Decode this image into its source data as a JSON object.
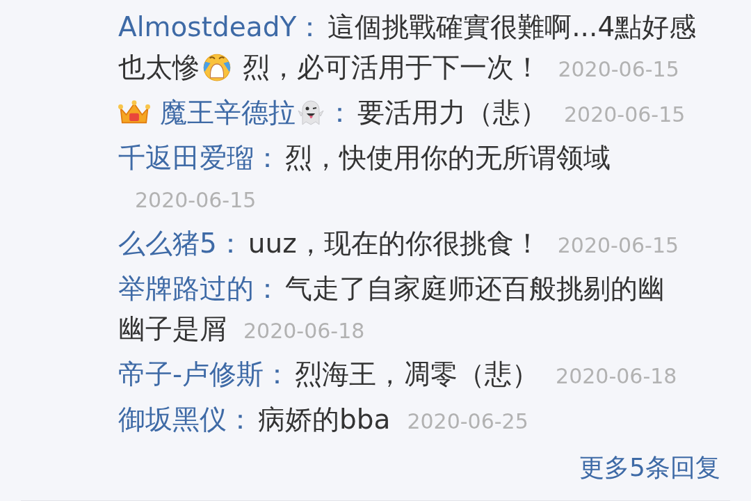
{
  "replies": [
    {
      "user": "AlmostdeadY",
      "separator": "：",
      "content": [
        {
          "kind": "text",
          "value": "這個挑戰確實很難啊...4點好感"
        },
        {
          "kind": "break"
        },
        {
          "kind": "text",
          "value": "也太慘"
        },
        {
          "kind": "crying_emoji"
        },
        {
          "kind": "text",
          "value": " 烈，必可活用于下一次！"
        }
      ],
      "date": "2020-06-15"
    },
    {
      "badge": {
        "kind": "crown"
      },
      "user": "魔王辛德拉",
      "name_emoji": {
        "kind": "ghost"
      },
      "separator": "：",
      "content": [
        {
          "kind": "text",
          "value": "要活用力（悲）"
        }
      ],
      "date": "2020-06-15"
    },
    {
      "user": "千返田爱瑠",
      "separator": "：",
      "content": [
        {
          "kind": "text",
          "value": "烈，快使用你的无所谓领域"
        }
      ],
      "date": "2020-06-15"
    },
    {
      "user": "么么猪5",
      "separator": "：",
      "content": [
        {
          "kind": "text",
          "value": "uuz，现在的你很挑食！"
        }
      ],
      "date": "2020-06-15"
    },
    {
      "user": "举牌路过的",
      "separator": "：",
      "content": [
        {
          "kind": "text",
          "value": "气走了自家庭师还百般挑剔的幽"
        },
        {
          "kind": "break"
        },
        {
          "kind": "text",
          "value": "幽子是屑"
        }
      ],
      "date": "2020-06-18"
    },
    {
      "user": "帝子-卢修斯",
      "separator": "：",
      "content": [
        {
          "kind": "text",
          "value": "烈海王，凋零（悲）"
        }
      ],
      "date": "2020-06-18"
    },
    {
      "user": "御坂黑仪",
      "separator": "：",
      "content": [
        {
          "kind": "text",
          "value": "病娇的bba"
        }
      ],
      "date": "2020-06-25"
    }
  ],
  "more_link": "更多5条回复"
}
